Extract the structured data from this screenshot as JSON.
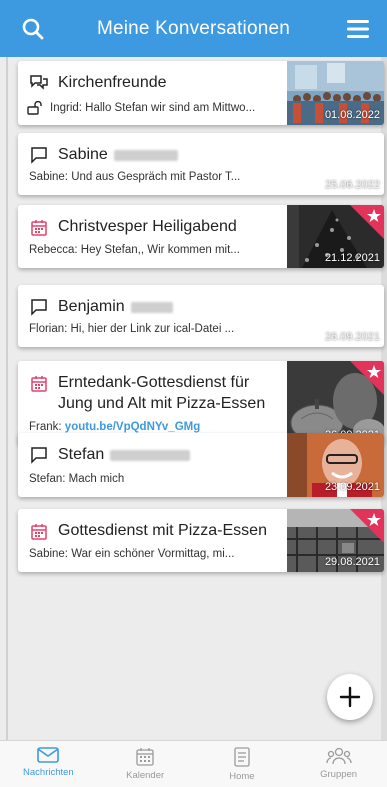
{
  "header": {
    "title": "Meine Konversationen",
    "search_icon": "search-icon",
    "menu_icon": "hamburger-menu-icon"
  },
  "colors": {
    "primary": "#3d9ae0",
    "event": "#e2436a",
    "favorite": "#e2335a"
  },
  "conversations": [
    {
      "type": "group",
      "name": "Kirchenfreunde",
      "preview": "Ingrid: Hallo Stefan wir sind am Mittwo...",
      "date": "01.08.2022",
      "locked": true,
      "favorite": false
    },
    {
      "type": "chat",
      "name": "Sabine",
      "preview": "Sabine: Und aus Gespräch mit Pastor T...",
      "date": "25.06.2022",
      "favorite": false
    },
    {
      "type": "event",
      "name": "Christvesper Heiligabend",
      "preview": "Rebecca: Hey Stefan,, Wir kommen mit...",
      "date": "21.12.2021",
      "favorite": true
    },
    {
      "type": "chat",
      "name": "Benjamin",
      "preview": "Florian: Hi, hier der Link zur ical-Datei ...",
      "date": "26.09.2021",
      "favorite": false
    },
    {
      "type": "event",
      "name_line1": "Erntedank-Gottesdienst für",
      "name_line2": "Jung und Alt mit Pizza-Essen",
      "preview_prefix": "Frank: ",
      "preview_link": "youtu.be/VpQdNYv_GMg",
      "date": "26.09.2021",
      "favorite": true
    },
    {
      "type": "chat",
      "name": "Stefan",
      "preview": "Stefan: Mach mich",
      "date": "23.09.2021",
      "favorite": false
    },
    {
      "type": "event",
      "name": "Gottesdienst mit Pizza-Essen",
      "preview": "Sabine: War ein schöner Vormittag, mi...",
      "date": "29.08.2021",
      "favorite": true
    }
  ],
  "fab": {
    "icon": "plus-icon"
  },
  "tabs": [
    {
      "label": "Nachrichten",
      "icon": "envelope-icon",
      "active": true
    },
    {
      "label": "Kalender",
      "icon": "calendar-icon",
      "active": false
    },
    {
      "label": "Home",
      "icon": "home-list-icon",
      "active": false
    },
    {
      "label": "Gruppen",
      "icon": "group-icon",
      "active": false
    }
  ]
}
